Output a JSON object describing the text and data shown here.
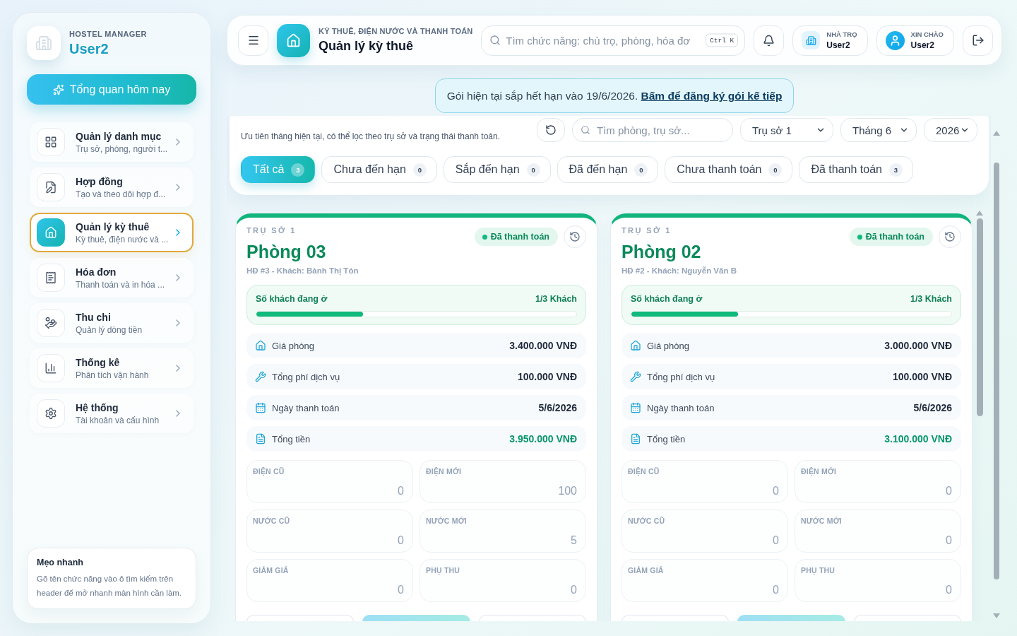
{
  "sidebar": {
    "brand": {
      "caption": "HOSTEL MANAGER",
      "name": "User2"
    },
    "overview_button": {
      "label": "Tổng quan hôm nay"
    },
    "nav_items": [
      {
        "title": "Quản lý danh mục",
        "subtitle": "Trụ sở, phòng, người t...",
        "selected": false
      },
      {
        "title": "Hợp đồng",
        "subtitle": "Tạo và theo dõi hợp đ...",
        "selected": false
      },
      {
        "title": "Quản lý kỳ thuê",
        "subtitle": "Kỳ thuê, điện nước và ...",
        "selected": true
      },
      {
        "title": "Hóa đơn",
        "subtitle": "Thanh toán và in hóa ...",
        "selected": false
      },
      {
        "title": "Thu chi",
        "subtitle": "Quản lý dòng tiền",
        "selected": false
      },
      {
        "title": "Thống kê",
        "subtitle": "Phân tích vận hành",
        "selected": false
      },
      {
        "title": "Hệ thống",
        "subtitle": "Tài khoản và cấu hình",
        "selected": false
      }
    ],
    "tip": {
      "title": "Mẹo nhanh",
      "text": "Gõ tên chức năng vào ô tìm kiếm trên header để mở nhanh màn hình cần làm."
    }
  },
  "header": {
    "eyebrow": "KỲ THUÊ, ĐIỆN NƯỚC VÀ THANH TOÁN",
    "title": "Quản lý kỳ thuê",
    "search": {
      "placeholder": "Tìm chức năng: chủ trọ, phòng, hóa đơ",
      "shortcut": "Ctrl K"
    },
    "chips": [
      {
        "kind": "hostel",
        "caption": "NHÀ TRỌ",
        "value": "User2"
      },
      {
        "kind": "user",
        "caption": "XIN CHÀO",
        "value": "User2"
      }
    ]
  },
  "notice": {
    "text": "Gói hiện tại sắp hết hạn vào 19/6/2026.",
    "link": "Bấm để đăng ký gói kế tiếp"
  },
  "filters": {
    "subtitle": "Ưu tiên tháng hiện tại, có thể lọc theo trụ sở và trạng thái thanh toán.",
    "search": {
      "placeholder": "Tìm phòng, trụ sở..."
    },
    "selects": [
      {
        "value": "Trụ sở 1"
      },
      {
        "value": "Tháng 6"
      },
      {
        "value": "2026"
      }
    ],
    "tabs": [
      {
        "label": "Tất cả",
        "count": "3",
        "selected": true
      },
      {
        "label": "Chưa đến hạn",
        "count": "0",
        "selected": false
      },
      {
        "label": "Sắp đến hạn",
        "count": "0",
        "selected": false
      },
      {
        "label": "Đã đến hạn",
        "count": "0",
        "selected": false
      },
      {
        "label": "Chưa thanh toán",
        "count": "0",
        "selected": false
      },
      {
        "label": "Đã thanh toán",
        "count": "3",
        "selected": false
      }
    ]
  },
  "cards": [
    {
      "branch": "TRỤ SỞ 1",
      "room": "Phòng 03",
      "contract": "HĐ #3 - Khách: Bành Thị Tỏn",
      "status": {
        "kind": "paid",
        "label": "Đã thanh toán"
      },
      "occupancy": {
        "label": "Số khách đang ở",
        "reading": "1/3 Khách",
        "level": 0.333
      },
      "details": [
        {
          "label": "Giá phòng",
          "value": "3.400.000 VNĐ",
          "highlighted": false
        },
        {
          "label": "Tổng phí dịch vụ",
          "value": "100.000 VNĐ",
          "highlighted": false
        },
        {
          "label": "Ngày thanh toán",
          "value": "5/6/2026",
          "highlighted": false
        },
        {
          "label": "Tổng tiền",
          "value": "3.950.000 VNĐ",
          "highlighted": true
        }
      ],
      "readings": [
        {
          "label": "ĐIỆN CŨ",
          "value": "0"
        },
        {
          "label": "ĐIỆN MỚI",
          "value": "100"
        },
        {
          "label": "NƯỚC CŨ",
          "value": "0"
        },
        {
          "label": "NƯỚC MỚI",
          "value": "5"
        },
        {
          "label": "GIẢM GIÁ",
          "value": "0"
        },
        {
          "label": "PHỤ THU",
          "value": "0"
        }
      ],
      "actions": [
        {
          "kind": "secondary"
        },
        {
          "kind": "primary"
        },
        {
          "kind": "secondary"
        }
      ]
    },
    {
      "branch": "TRỤ SỞ 1",
      "room": "Phòng 02",
      "contract": "HĐ #2 - Khách: Nguyễn Văn B",
      "status": {
        "kind": "paid",
        "label": "Đã thanh toán"
      },
      "occupancy": {
        "label": "Số khách đang ở",
        "reading": "1/3 Khách",
        "level": 0.333
      },
      "details": [
        {
          "label": "Giá phòng",
          "value": "3.000.000 VNĐ",
          "highlighted": false
        },
        {
          "label": "Tổng phí dịch vụ",
          "value": "100.000 VNĐ",
          "highlighted": false
        },
        {
          "label": "Ngày thanh toán",
          "value": "5/6/2026",
          "highlighted": false
        },
        {
          "label": "Tổng tiền",
          "value": "3.100.000 VNĐ",
          "highlighted": true
        }
      ],
      "readings": [
        {
          "label": "ĐIỆN CŨ",
          "value": "0"
        },
        {
          "label": "ĐIỆN MỚI",
          "value": "0"
        },
        {
          "label": "NƯỚC CŨ",
          "value": "0"
        },
        {
          "label": "NƯỚC MỚI",
          "value": "0"
        },
        {
          "label": "GIẢM GIÁ",
          "value": "0"
        },
        {
          "label": "PHỤ THU",
          "value": "0"
        }
      ],
      "actions": [
        {
          "kind": "secondary"
        },
        {
          "kind": "primary"
        },
        {
          "kind": "secondary"
        }
      ]
    }
  ]
}
